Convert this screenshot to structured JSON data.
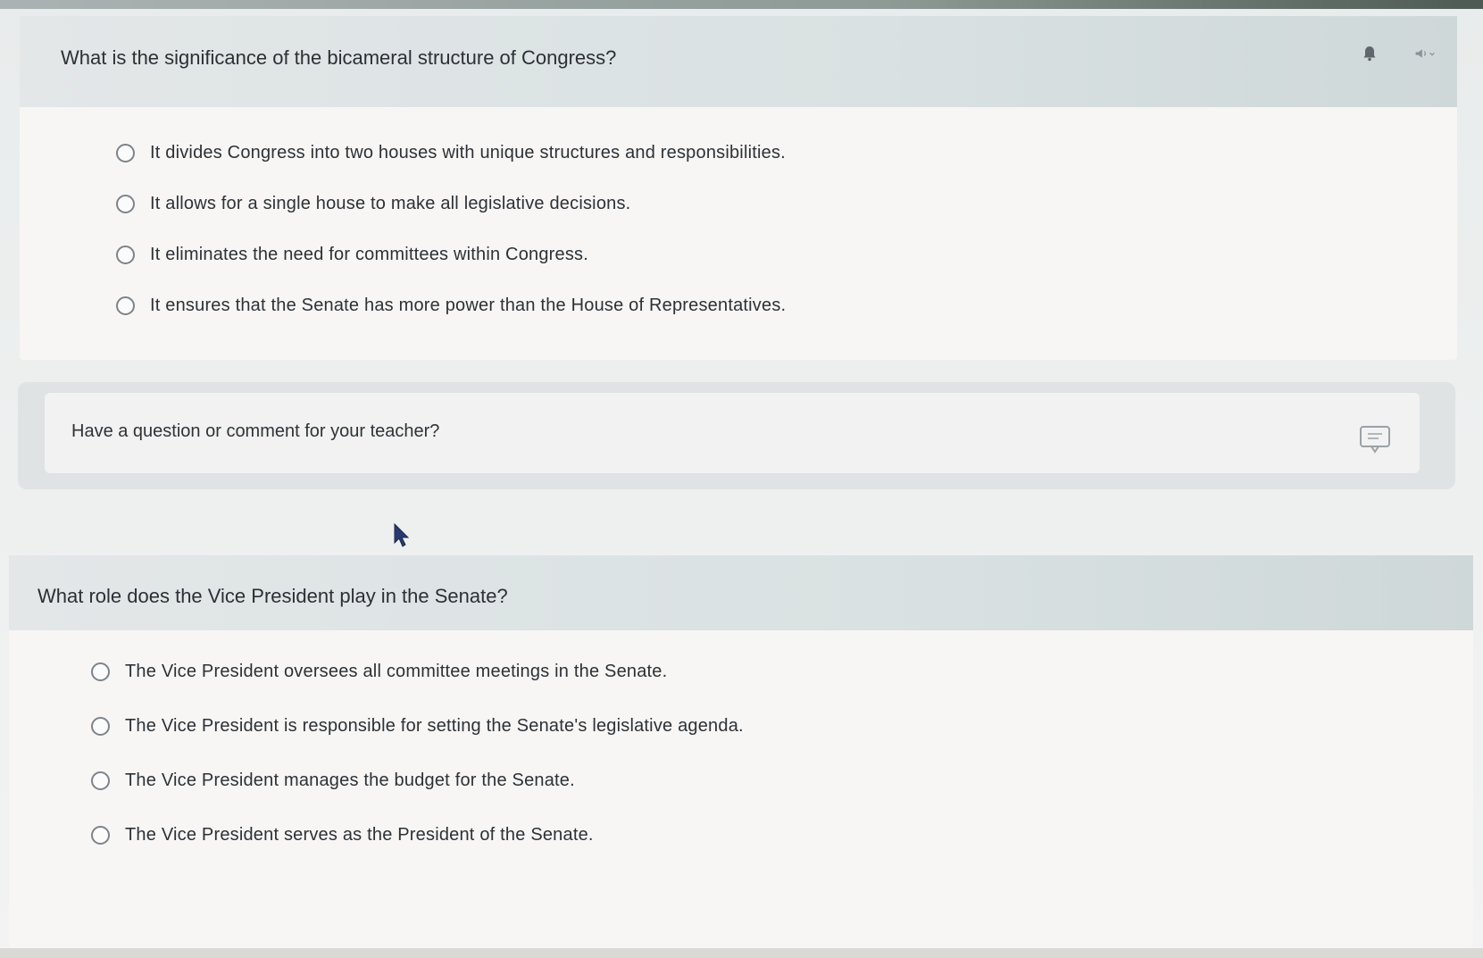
{
  "questions": [
    {
      "text": "What is the significance of the bicameral structure of Congress?",
      "tools": [
        "bell-icon",
        "audio-icon"
      ],
      "options": [
        "It divides Congress into two houses with unique structures and responsibilities.",
        "It allows for a single house to make all legislative decisions.",
        "It eliminates the need for committees within Congress.",
        "It ensures that the Senate has more power than the House of Representatives."
      ]
    },
    {
      "text": "What role does the Vice President play in the Senate?",
      "options": [
        "The Vice President oversees all committee meetings in the Senate.",
        "The Vice President is responsible for setting the Senate's legislative agenda.",
        "The Vice President manages the budget for the Senate.",
        "The Vice President serves as the President of the Senate."
      ]
    }
  ],
  "comment": {
    "prompt": "Have a question or comment for your teacher?",
    "icon": "comment-icon"
  }
}
